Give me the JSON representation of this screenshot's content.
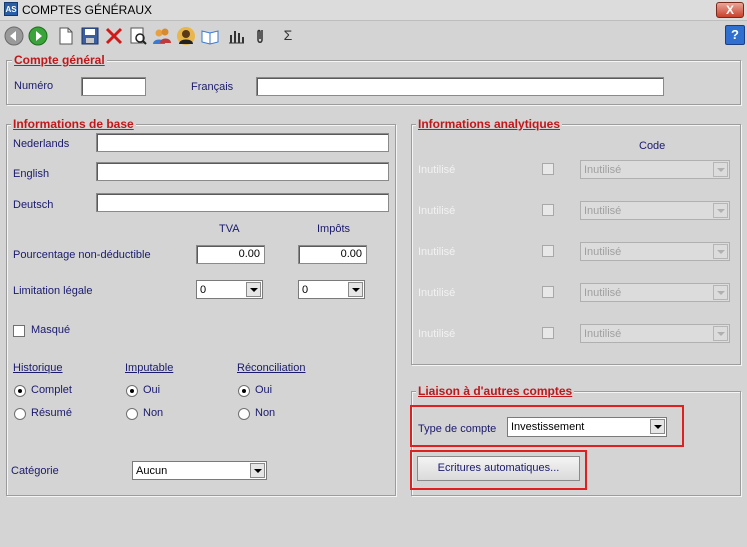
{
  "window": {
    "title": "COMPTES GÉNÉRAUX",
    "app_icon_text": "AS",
    "close_label": "X"
  },
  "toolbar": {
    "help_label": "?",
    "sigma_label": "Σ"
  },
  "compte_general": {
    "legend": "Compte général",
    "numero_label": "Numéro",
    "numero_value": "",
    "francais_label": "Français",
    "francais_value": ""
  },
  "info_base": {
    "legend": "Informations de base",
    "nederlands_label": "Nederlands",
    "english_label": "English",
    "deutsch_label": "Deutsch",
    "tva_header": "TVA",
    "impots_header": "Impôts",
    "pourcentage_label": "Pourcentage non-déductible",
    "pourcentage_tva": "0.00",
    "pourcentage_impots": "0.00",
    "limitation_label": "Limitation légale",
    "limitation_tva": "0",
    "limitation_impots": "0",
    "masque_label": "Masqué",
    "historique_label": "Historique",
    "historique_complet": "Complet",
    "historique_resume": "Résumé",
    "imputable_label": "Imputable",
    "imputable_oui": "Oui",
    "imputable_non": "Non",
    "reconciliation_label": "Réconciliation",
    "reconciliation_oui": "Oui",
    "reconciliation_non": "Non",
    "categorie_label": "Catégorie",
    "categorie_value": "Aucun"
  },
  "info_analytiques": {
    "legend": "Informations analytiques",
    "code_header": "Code",
    "rows": [
      {
        "label": "Inutilisé",
        "value": "Inutilisé"
      },
      {
        "label": "Inutilisé",
        "value": "Inutilisé"
      },
      {
        "label": "Inutilisé",
        "value": "Inutilisé"
      },
      {
        "label": "Inutilisé",
        "value": "Inutilisé"
      },
      {
        "label": "Inutilisé",
        "value": "Inutilisé"
      }
    ]
  },
  "liaison": {
    "legend": "Liaison à d'autres comptes",
    "type_label": "Type de compte",
    "type_value": "Investissement",
    "ecritures_button": "Ecritures automatiques..."
  },
  "colors": {
    "legend_red": "#c0171a",
    "label_blue": "#1a1a6e",
    "highlight_red": "#e02020",
    "background": "#d4d4d4"
  }
}
